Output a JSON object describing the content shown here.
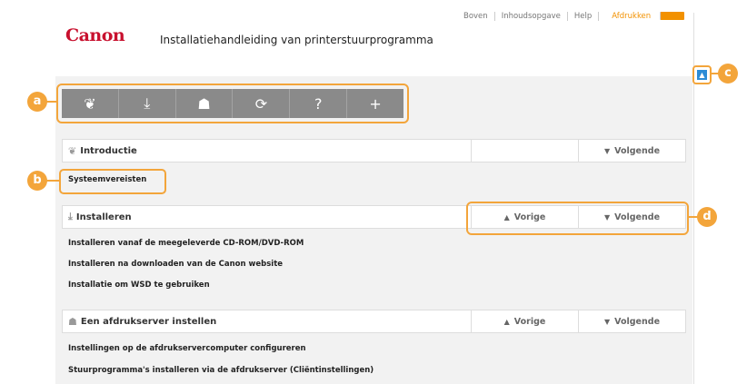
{
  "header": {
    "brand": "Canon",
    "title": "Installatiehandleiding van printerstuurprogramma",
    "links": [
      "Boven",
      "Inhoudsopgave",
      "Help",
      "Afdrukken"
    ]
  },
  "toolbar": {
    "icons": [
      "sprout-icon",
      "download-icon",
      "network-icon",
      "refresh-icon",
      "help-icon",
      "plus-icon"
    ],
    "glyphs": [
      "❦",
      "⤓",
      "☗",
      "⟳",
      "?",
      "+"
    ]
  },
  "callouts": {
    "a": "a",
    "b": "b",
    "c": "c",
    "d": "d"
  },
  "sections": [
    {
      "title": "Introductie",
      "prev": "",
      "next": "Volgende",
      "links": [
        "Systeemvereisten"
      ]
    },
    {
      "title": "Installeren",
      "prev": "Vorige",
      "next": "Volgende",
      "links": [
        "Installeren vanaf de meegeleverde CD-ROM/DVD-ROM",
        "Installeren na downloaden van de Canon website",
        "Installatie om WSD te gebruiken"
      ]
    },
    {
      "title": "Een afdrukserver instellen",
      "prev": "Vorige",
      "next": "Volgende",
      "links": [
        "Instellingen op de afdrukservercomputer configureren",
        "Stuurprogramma's installeren via de afdrukserver (Cliëntinstellingen)"
      ]
    }
  ],
  "colors": {
    "accent": "#f3a53b",
    "brand": "#c8102e",
    "toolbar": "#8a8a8a"
  }
}
